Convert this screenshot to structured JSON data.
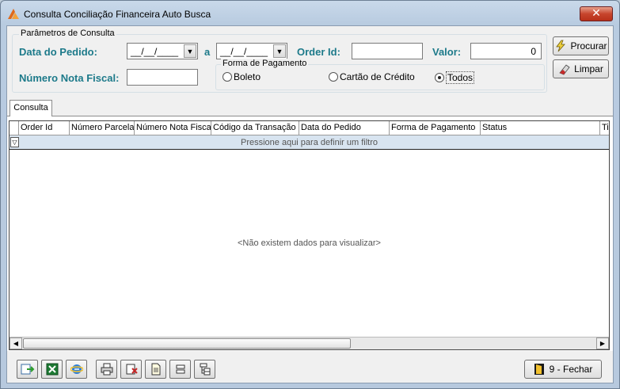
{
  "window": {
    "title": "Consulta Conciliação Financeira Auto Busca",
    "close_label": "✕"
  },
  "params": {
    "legend": "Parâmetros de Consulta",
    "data_pedido_label": "Data do Pedido:",
    "date_from": "__/__/____",
    "date_sep": "a",
    "date_to": "__/__/____",
    "order_id_label": "Order Id:",
    "order_id_value": "",
    "valor_label": "Valor:",
    "valor_value": "0",
    "nota_fiscal_label": "Número Nota Fiscal:",
    "nota_fiscal_value": "",
    "forma_pagamento": {
      "legend": "Forma de Pagamento",
      "options": [
        {
          "label": "Boleto",
          "selected": false
        },
        {
          "label": "Cartão de Crédito",
          "selected": false
        },
        {
          "label": "Todos",
          "selected": true
        }
      ]
    }
  },
  "buttons": {
    "procurar": "Procurar",
    "limpar": "Limpar",
    "fechar": "9 - Fechar"
  },
  "tabs": [
    {
      "label": "Consulta",
      "active": true
    }
  ],
  "grid": {
    "columns": [
      "Order Id",
      "Número Parcela",
      "Número Nota Fiscal",
      "Código da Transação",
      "Data do Pedido",
      "Forma de Pagamento",
      "Status",
      "Tip"
    ],
    "filter_prompt": "Pressione aqui para definir um filtro",
    "empty_message": "<Não existem dados para visualizar>",
    "rows": []
  },
  "toolbar": {
    "icons": [
      "export-icon",
      "excel-icon",
      "internet-explorer-icon",
      "print-icon",
      "print-preview-icon",
      "page-setup-icon",
      "collapse-icon",
      "expand-icon"
    ]
  },
  "colors": {
    "label_accent": "#1d7a8a",
    "filter_row": "#d8e4f0",
    "close_button": "#c7452d"
  }
}
